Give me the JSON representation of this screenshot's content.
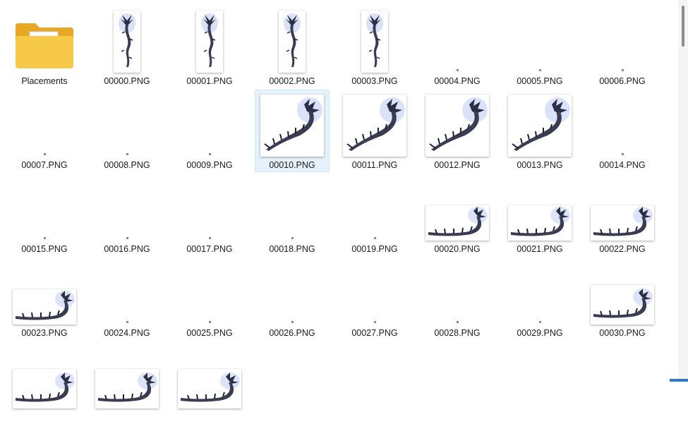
{
  "folder": {
    "label": "Placements",
    "icon": "folder-icon"
  },
  "files": [
    {
      "name": "00000.PNG",
      "thumb": "tall"
    },
    {
      "name": "00001.PNG",
      "thumb": "tall"
    },
    {
      "name": "00002.PNG",
      "thumb": "tall"
    },
    {
      "name": "00003.PNG",
      "thumb": "tall"
    },
    {
      "name": "00004.PNG",
      "thumb": "dot"
    },
    {
      "name": "00005.PNG",
      "thumb": "dot"
    },
    {
      "name": "00006.PNG",
      "thumb": "dot"
    },
    {
      "name": "00007.PNG",
      "thumb": "dot"
    },
    {
      "name": "00008.PNG",
      "thumb": "dot"
    },
    {
      "name": "00009.PNG",
      "thumb": "dot"
    },
    {
      "name": "00010.PNG",
      "thumb": "square",
      "selected": true
    },
    {
      "name": "00011.PNG",
      "thumb": "square"
    },
    {
      "name": "00012.PNG",
      "thumb": "square"
    },
    {
      "name": "00013.PNG",
      "thumb": "square"
    },
    {
      "name": "00014.PNG",
      "thumb": "dot"
    },
    {
      "name": "00015.PNG",
      "thumb": "dot"
    },
    {
      "name": "00016.PNG",
      "thumb": "dot"
    },
    {
      "name": "00017.PNG",
      "thumb": "dot"
    },
    {
      "name": "00018.PNG",
      "thumb": "dot"
    },
    {
      "name": "00019.PNG",
      "thumb": "dot"
    },
    {
      "name": "00020.PNG",
      "thumb": "wide"
    },
    {
      "name": "00021.PNG",
      "thumb": "wide"
    },
    {
      "name": "00022.PNG",
      "thumb": "wide"
    },
    {
      "name": "00023.PNG",
      "thumb": "wide"
    },
    {
      "name": "00024.PNG",
      "thumb": "dot"
    },
    {
      "name": "00025.PNG",
      "thumb": "dot"
    },
    {
      "name": "00026.PNG",
      "thumb": "dot"
    },
    {
      "name": "00027.PNG",
      "thumb": "dot"
    },
    {
      "name": "00028.PNG",
      "thumb": "dot"
    },
    {
      "name": "00029.PNG",
      "thumb": "dot"
    },
    {
      "name": "00030.PNG",
      "thumb": "wide-tall"
    },
    {
      "name": "",
      "thumb": "wide-tall"
    },
    {
      "name": "",
      "thumb": "wide-tall"
    },
    {
      "name": "",
      "thumb": "wide-tall"
    }
  ],
  "colors": {
    "selection_bg": "#e5f1fb",
    "selection_border": "#cce8ff",
    "folder_body": "#f7c948",
    "folder_back": "#e8a825"
  }
}
